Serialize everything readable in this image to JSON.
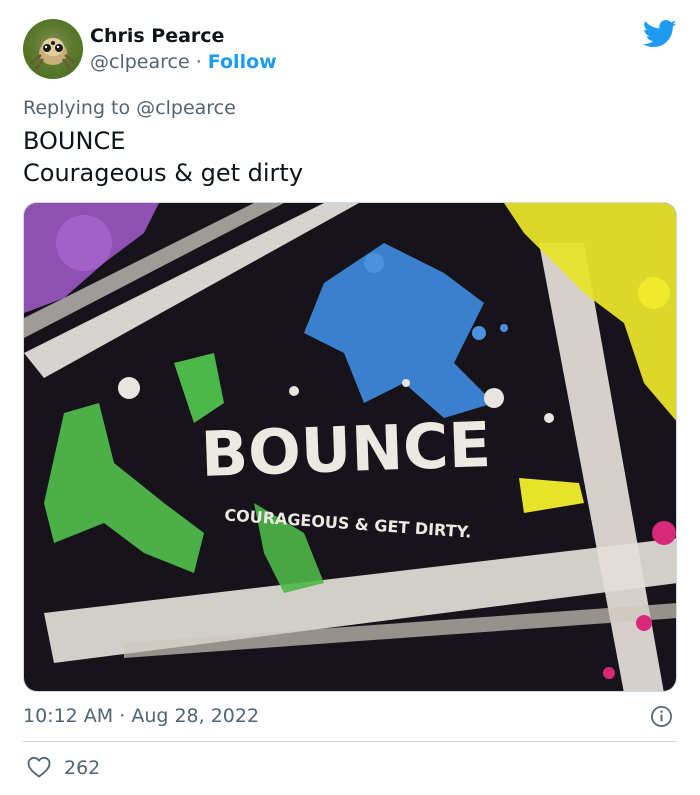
{
  "author": {
    "display_name": "Chris Pearce",
    "handle": "@clpearce",
    "separator": "·",
    "follow_label": "Follow"
  },
  "reply": {
    "prefix": "Replying to",
    "mention": "@clpearce"
  },
  "tweet": {
    "line1": "BOUNCE",
    "line2": "Courageous & get dirty"
  },
  "media": {
    "title_text": "BOUNCE",
    "tagline_text": "COURAGEOUS & GET DIRTY."
  },
  "meta": {
    "time": "10:12 AM",
    "separator": "·",
    "date": "Aug 28, 2022"
  },
  "engagement": {
    "likes": "262"
  },
  "icons": {
    "brand": "twitter-bird-icon",
    "info": "info-icon",
    "like": "heart-icon"
  },
  "colors": {
    "accent": "#1d9bf0",
    "secondary_text": "#536471",
    "divider": "#cfd9de"
  }
}
